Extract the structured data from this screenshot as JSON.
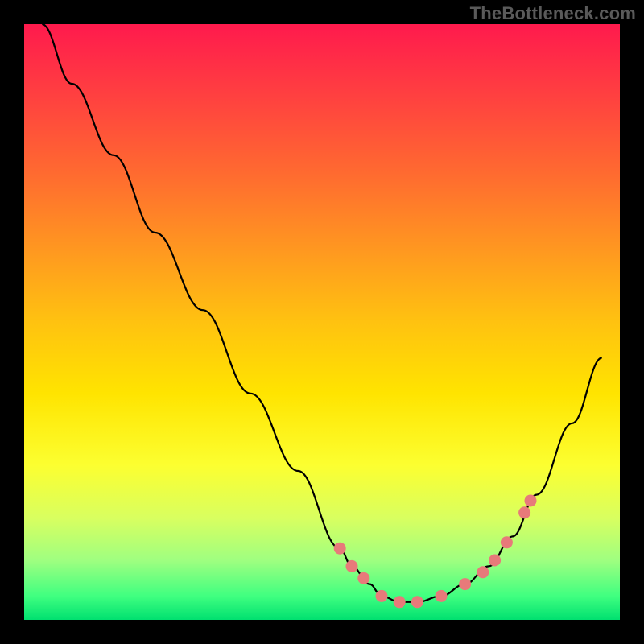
{
  "watermark": "TheBottleneck.com",
  "chart_data": {
    "type": "line",
    "title": "",
    "xlabel": "",
    "ylabel": "",
    "xlim": [
      0,
      100
    ],
    "ylim": [
      0,
      100
    ],
    "series": [
      {
        "name": "curve",
        "x": [
          3,
          8,
          15,
          22,
          30,
          38,
          46,
          53,
          55,
          58,
          60,
          63,
          66,
          70,
          74,
          78,
          82,
          86,
          92,
          97
        ],
        "y": [
          100,
          90,
          78,
          65,
          52,
          38,
          25,
          12,
          9,
          6,
          4,
          3,
          3,
          4,
          6,
          9,
          14,
          21,
          33,
          44
        ]
      }
    ],
    "points": {
      "name": "markers",
      "color": "#e77a7a",
      "x": [
        53,
        55,
        57,
        60,
        63,
        66,
        70,
        74,
        77,
        79,
        81,
        84,
        85
      ],
      "y": [
        12,
        9,
        7,
        4,
        3,
        3,
        4,
        6,
        8,
        10,
        13,
        18,
        20
      ]
    }
  }
}
